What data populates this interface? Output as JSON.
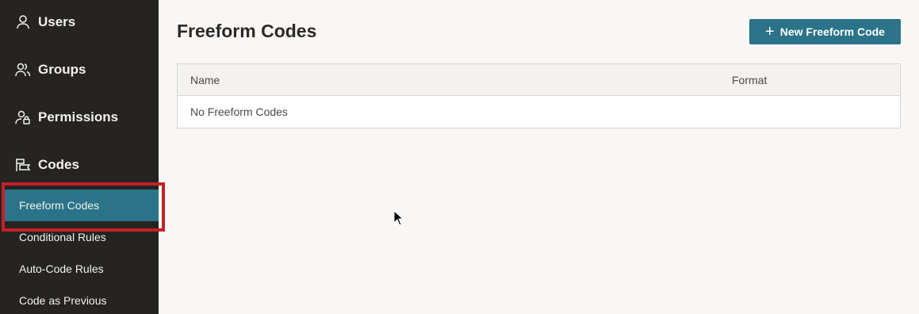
{
  "sidebar": {
    "nav": [
      {
        "label": "Users",
        "icon": "user-icon"
      },
      {
        "label": "Groups",
        "icon": "users-group-icon"
      },
      {
        "label": "Permissions",
        "icon": "user-lock-icon"
      },
      {
        "label": "Codes",
        "icon": "codes-flag-icon"
      }
    ],
    "sub_items": [
      {
        "label": "Freeform Codes",
        "active": true
      },
      {
        "label": "Conditional Rules",
        "active": false
      },
      {
        "label": "Auto-Code Rules",
        "active": false
      },
      {
        "label": "Code as Previous",
        "active": false
      }
    ]
  },
  "main": {
    "title": "Freeform Codes",
    "new_button_label": "New Freeform Code",
    "table": {
      "columns": [
        "Name",
        "Format"
      ],
      "empty_text": "No Freeform Codes"
    }
  },
  "colors": {
    "sidebar_bg": "#252420",
    "accent": "#2a7389",
    "highlight": "#c4202a"
  }
}
